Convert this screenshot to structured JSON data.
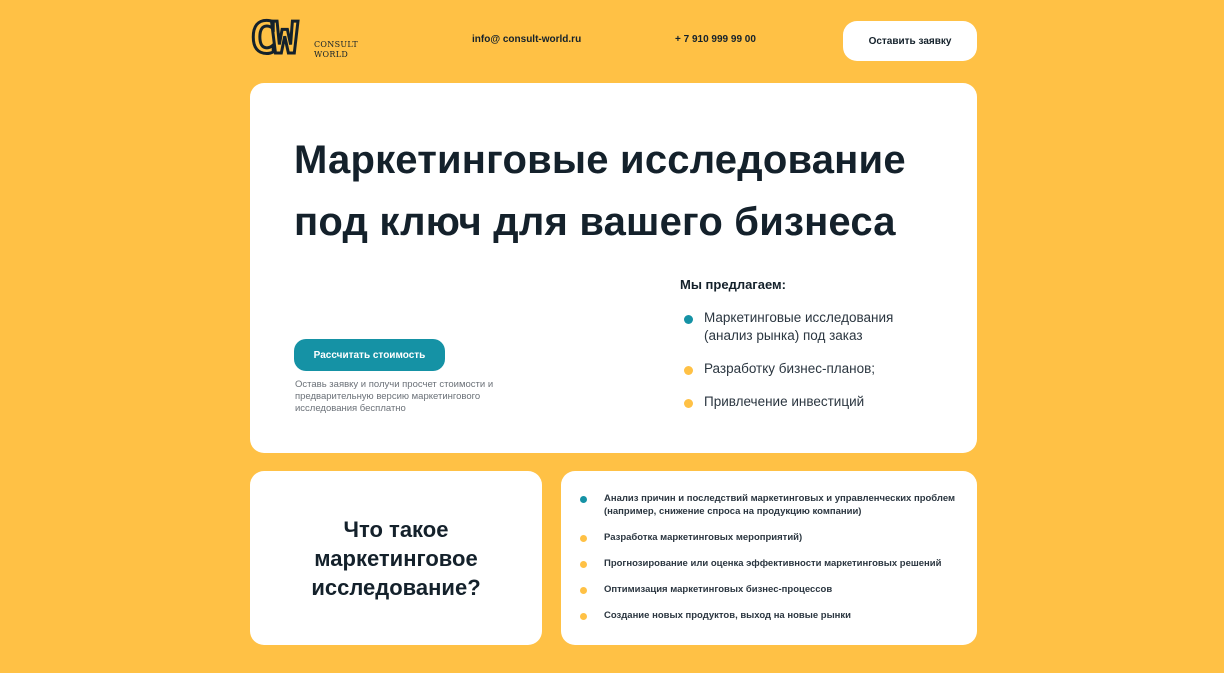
{
  "colors": {
    "background": "#FFC145",
    "accent_teal": "#1592A5",
    "accent_yellow": "#FFC145",
    "text_dark": "#14212B"
  },
  "header": {
    "logo_mark": "CW",
    "logo_line1": "CONSULT",
    "logo_line2": "WORLD",
    "email": "info@ consult-world.ru",
    "phone": "+ 7 910 999 99 00",
    "request_button": "Оставить заявку"
  },
  "hero": {
    "title": "Маркетинговые исследование под ключ для вашего бизнеса",
    "cta_button": "Рассчитать стоимость",
    "cta_note": "Оставь заявку и получи просчет стоимости и предварительную версию маркетингового исследования бесплатно",
    "offer_title": "Мы предлагаем:",
    "offer_items": [
      {
        "text": "Маркетинговые исследования (анализ рынка) под заказ",
        "dot": "#1592A5"
      },
      {
        "text": "Разработку бизнес-планов;",
        "dot": "#FFC145"
      },
      {
        "text": "Привлечение инвестиций",
        "dot": "#FFC145"
      }
    ]
  },
  "what_is": {
    "title": "Что такое маркетинговое исследование?"
  },
  "goals": {
    "items": [
      {
        "text": "Анализ причин и последствий маркетинговых и управленческих проблем (например, снижение спроса на продукцию компании)",
        "dot": "#1592A5"
      },
      {
        "text": "Разработка маркетинговых мероприятий)",
        "dot": "#FFC145"
      },
      {
        "text": "Прогнозирование или оценка эффективности маркетинговых решений",
        "dot": "#FFC145"
      },
      {
        "text": "Оптимизация маркетинговых бизнес-процессов",
        "dot": "#FFC145"
      },
      {
        "text": "Создание новых продуктов, выход на новые рынки",
        "dot": "#FFC145"
      }
    ]
  }
}
